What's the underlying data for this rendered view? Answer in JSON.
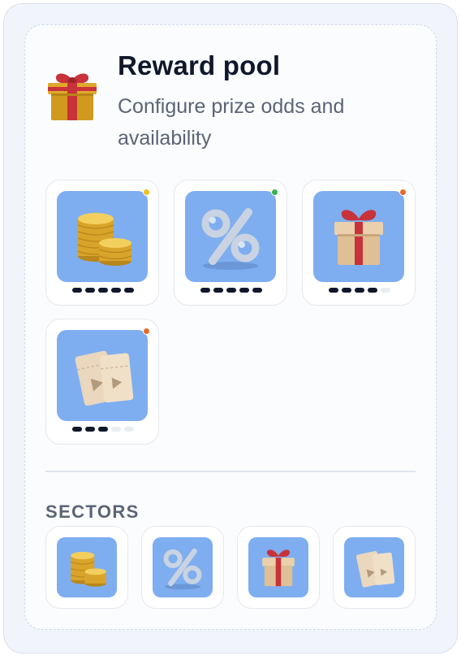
{
  "header": {
    "title": "Reward pool",
    "subtitle": "Configure prize odds and availability",
    "icon": "gift-icon"
  },
  "rewards": [
    {
      "name": "coins",
      "icon": "coins-icon",
      "status_color": "#f2c01e",
      "rating": 5,
      "rating_max": 5
    },
    {
      "name": "discount",
      "icon": "percent-icon",
      "status_color": "#37b24d",
      "rating": 5,
      "rating_max": 5
    },
    {
      "name": "gift",
      "icon": "gift-icon",
      "status_color": "#e8692a",
      "rating": 4,
      "rating_max": 5
    },
    {
      "name": "tickets",
      "icon": "ticket-icon",
      "status_color": "#e8692a",
      "rating": 3,
      "rating_max": 5
    }
  ],
  "sectors": {
    "label": "SECTORS",
    "items": [
      {
        "icon": "coins-icon"
      },
      {
        "icon": "percent-icon"
      },
      {
        "icon": "gift-icon"
      },
      {
        "icon": "ticket-icon"
      }
    ]
  },
  "colors": {
    "tile_background": "#7eaef0",
    "title": "#0f172a",
    "muted": "#5b6475"
  }
}
